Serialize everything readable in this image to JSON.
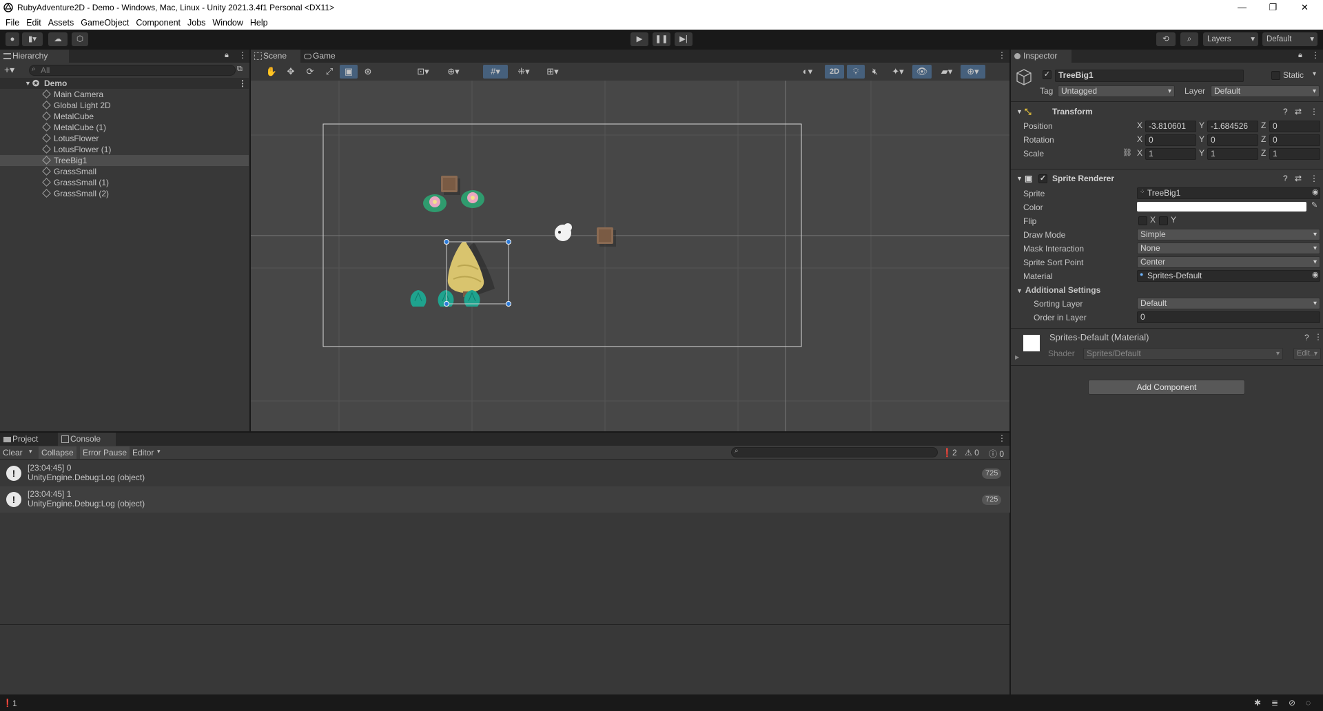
{
  "window": {
    "title": "RubyAdventure2D - Demo - Windows, Mac, Linux - Unity 2021.3.4f1 Personal <DX11>",
    "minimize": "—",
    "maximize": "❐",
    "close": "✕"
  },
  "menu": [
    "File",
    "Edit",
    "Assets",
    "GameObject",
    "Component",
    "Jobs",
    "Window",
    "Help"
  ],
  "toolbar": {
    "layers_label": "Layers",
    "layout_label": "Default"
  },
  "hierarchy": {
    "tab": "Hierarchy",
    "search_placeholder": "All",
    "scene": "Demo",
    "items": [
      "Main Camera",
      "Global Light 2D",
      "MetalCube",
      "MetalCube (1)",
      "LotusFlower",
      "LotusFlower (1)",
      "TreeBig1",
      "GrassSmall",
      "GrassSmall (1)",
      "GrassSmall (2)"
    ],
    "selected": "TreeBig1"
  },
  "scene_view": {
    "tabs": [
      "Scene",
      "Game"
    ],
    "mode_2d": "2D"
  },
  "inspector": {
    "tab": "Inspector",
    "object_name": "TreeBig1",
    "static_label": "Static",
    "tag_label": "Tag",
    "tag_value": "Untagged",
    "layer_label": "Layer",
    "layer_value": "Default",
    "transform": {
      "title": "Transform",
      "position_label": "Position",
      "rotation_label": "Rotation",
      "scale_label": "Scale",
      "position": {
        "x": "-3.810601",
        "y": "-1.684526",
        "z": "0"
      },
      "rotation": {
        "x": "0",
        "y": "0",
        "z": "0"
      },
      "scale": {
        "x": "1",
        "y": "1",
        "z": "1"
      }
    },
    "sprite_renderer": {
      "title": "Sprite Renderer",
      "sprite_label": "Sprite",
      "sprite_value": "TreeBig1",
      "color_label": "Color",
      "flip_label": "Flip",
      "flip_x": "X",
      "flip_y": "Y",
      "draw_mode_label": "Draw Mode",
      "draw_mode": "Simple",
      "mask_label": "Mask Interaction",
      "mask": "None",
      "sort_point_label": "Sprite Sort Point",
      "sort_point": "Center",
      "material_label": "Material",
      "material": "Sprites-Default",
      "additional_label": "Additional Settings",
      "sorting_layer_label": "Sorting Layer",
      "sorting_layer": "Default",
      "order_label": "Order in Layer",
      "order": "0"
    },
    "material": {
      "title": "Sprites-Default (Material)",
      "shader_label": "Shader",
      "shader": "Sprites/Default",
      "edit": "Edit..."
    },
    "add_component": "Add Component"
  },
  "bottom": {
    "tabs": [
      "Project",
      "Console"
    ],
    "console_buttons": [
      "Clear",
      "Collapse",
      "Error Pause",
      "Editor"
    ],
    "count_errors": "2",
    "count_warnings": "0",
    "count_info": "0",
    "logs": [
      {
        "time": "[23:04:45] 0",
        "msg": "UnityEngine.Debug:Log (object)",
        "count": "725"
      },
      {
        "time": "[23:04:45] 1",
        "msg": "UnityEngine.Debug:Log (object)",
        "count": "725"
      }
    ]
  },
  "statusbar": {
    "text": "1"
  },
  "colors": {
    "accent": "#46607c",
    "selection_handle": "#2d7bd8",
    "bg_dark": "#191919",
    "panel": "#383838",
    "scene_bg": "#474747"
  }
}
